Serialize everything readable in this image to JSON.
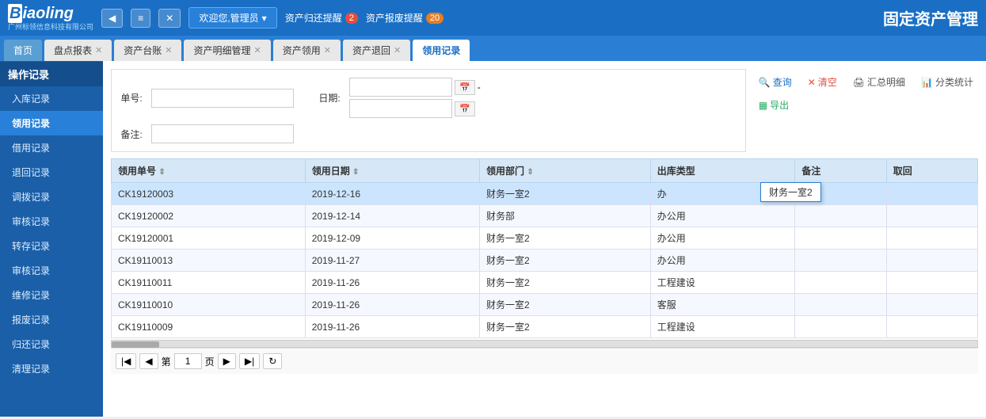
{
  "header": {
    "logo_text": "Biaoling",
    "logo_sub": "广州标领信息科技有限公司",
    "nav_back": "◀",
    "nav_menu": "≡",
    "nav_close": "✕",
    "welcome_text": "欢迎您,管理员",
    "alert1_text": "资产归还提醒",
    "alert1_badge": "2",
    "alert2_text": "资产报废提醒",
    "alert2_badge": "20",
    "system_title": "固定资产管理"
  },
  "tabs": [
    {
      "label": "首页",
      "closable": false,
      "active": false
    },
    {
      "label": "盘点报表",
      "closable": true,
      "active": false
    },
    {
      "label": "资产台账",
      "closable": true,
      "active": false
    },
    {
      "label": "资产明细管理",
      "closable": true,
      "active": false
    },
    {
      "label": "资产领用",
      "closable": true,
      "active": false
    },
    {
      "label": "资产退回",
      "closable": true,
      "active": false
    },
    {
      "label": "领用记录",
      "closable": false,
      "active": true
    }
  ],
  "sidebar": {
    "group_label": "操作记录",
    "items": [
      {
        "label": "入库记录",
        "active": false
      },
      {
        "label": "领用记录",
        "active": true
      },
      {
        "label": "借用记录",
        "active": false
      },
      {
        "label": "退回记录",
        "active": false
      },
      {
        "label": "调拨记录",
        "active": false
      },
      {
        "label": "审核记录",
        "active": false
      },
      {
        "label": "转存记录",
        "active": false
      },
      {
        "label": "审核记录",
        "active": false
      },
      {
        "label": "维修记录",
        "active": false
      },
      {
        "label": "报废记录",
        "active": false
      },
      {
        "label": "归还记录",
        "active": false
      },
      {
        "label": "清理记录",
        "active": false
      }
    ]
  },
  "form": {
    "label_number": "单号:",
    "label_date": "日期:",
    "label_remark": "备注:",
    "placeholder_number": "",
    "placeholder_remark": "",
    "date_from": "",
    "date_to": ""
  },
  "toolbar": {
    "query_label": "查询",
    "clear_label": "清空",
    "summary_label": "汇总明细",
    "category_label": "分类统计",
    "export_label": "导出"
  },
  "table": {
    "columns": [
      "领用单号",
      "领用日期",
      "领用部门",
      "出库类型",
      "备注",
      "取回"
    ],
    "rows": [
      {
        "id": "CK19120003",
        "date": "2019-12-16",
        "dept": "财务一室2",
        "type": "办",
        "remark": "",
        "return": ""
      },
      {
        "id": "CK19120002",
        "date": "2019-12-14",
        "dept": "财务部",
        "type": "办公用",
        "remark": "",
        "return": ""
      },
      {
        "id": "CK19120001",
        "date": "2019-12-09",
        "dept": "财务一室2",
        "type": "办公用",
        "remark": "",
        "return": ""
      },
      {
        "id": "CK19110013",
        "date": "2019-11-27",
        "dept": "财务一室2",
        "type": "办公用",
        "remark": "",
        "return": ""
      },
      {
        "id": "CK19110011",
        "date": "2019-11-26",
        "dept": "财务一室2",
        "type": "工程建设",
        "remark": "",
        "return": ""
      },
      {
        "id": "CK19110010",
        "date": "2019-11-26",
        "dept": "财务一室2",
        "type": "客服",
        "remark": "",
        "return": ""
      },
      {
        "id": "CK19110009",
        "date": "2019-11-26",
        "dept": "财务一室2",
        "type": "工程建设",
        "remark": "",
        "return": ""
      }
    ],
    "tooltip": "财务一室2"
  },
  "pagination": {
    "prev_label": "◀",
    "next_label": "▶",
    "first_label": "|◀",
    "last_label": "▶|",
    "refresh_label": "↻"
  }
}
